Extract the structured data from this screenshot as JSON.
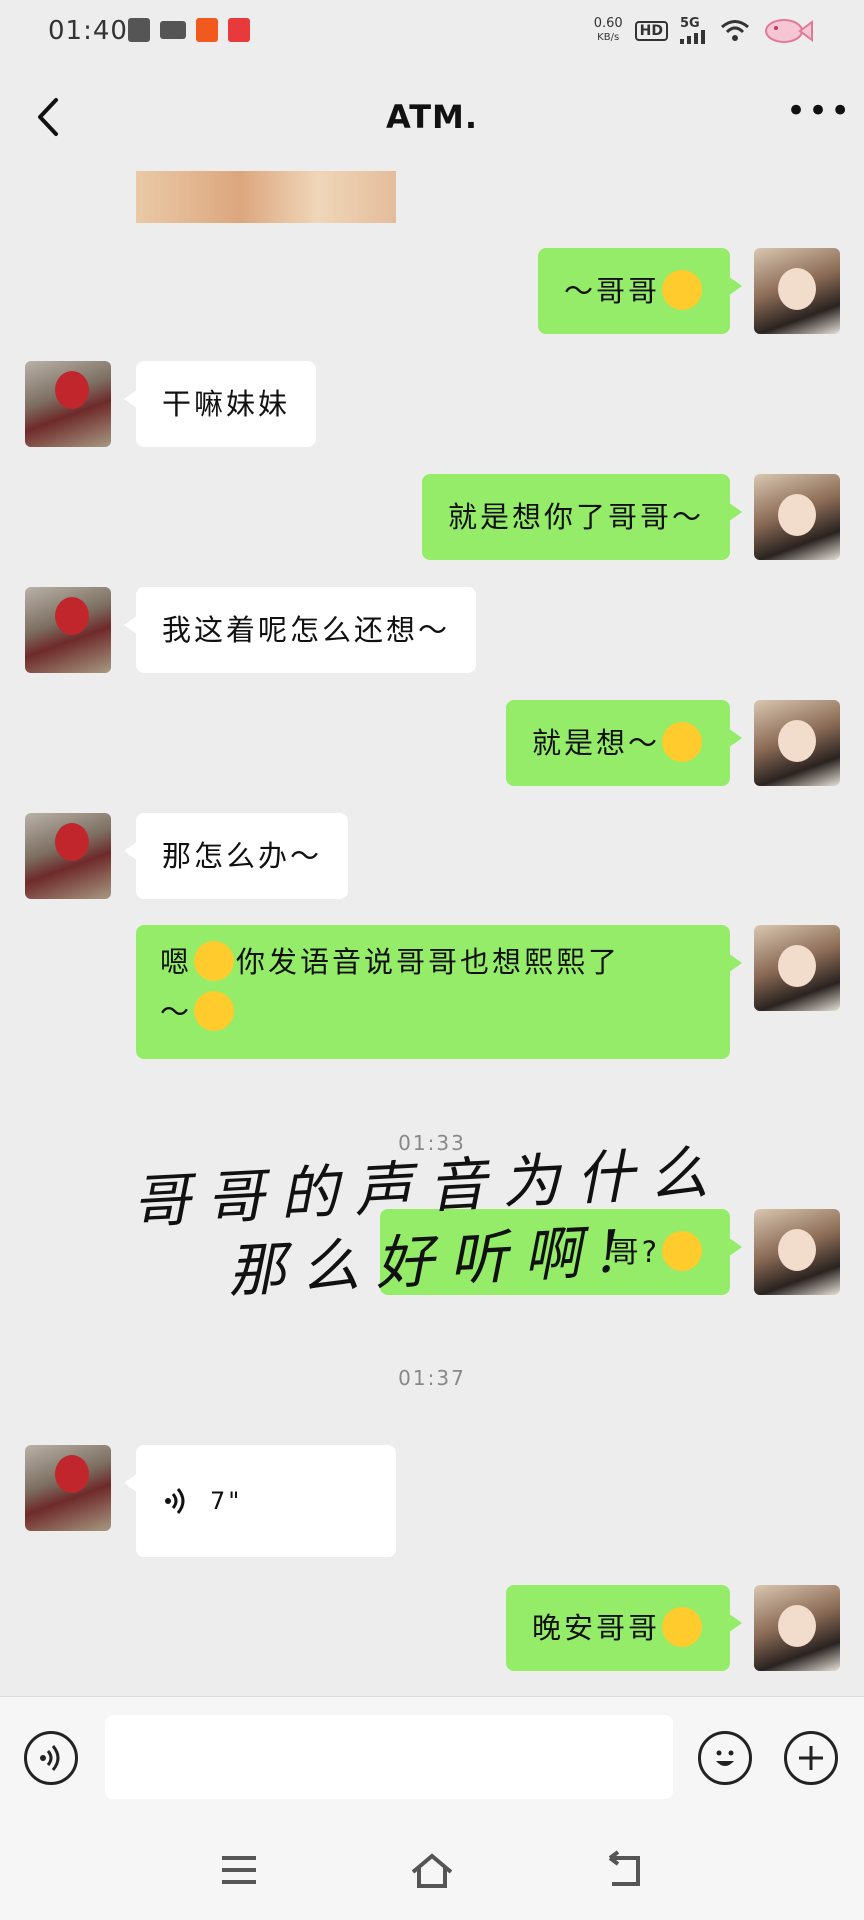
{
  "status_bar": {
    "time": "01:40",
    "net_speed": "0.60",
    "net_unit": "KB/s",
    "hd": "HD",
    "signal": "5G"
  },
  "header": {
    "title": "ATM."
  },
  "messages": [
    {
      "text": "～哥哥",
      "emoji": "winking-face-with-tongue"
    },
    {
      "text": "干嘛妹妹"
    },
    {
      "text": "就是想你了哥哥～"
    },
    {
      "text": "我这着呢怎么还想～"
    },
    {
      "text": "就是想～",
      "emoji": "face-with-hand-over-mouth"
    },
    {
      "text": "那怎么办～"
    },
    {
      "text_before": "嗯",
      "text_mid": "你发语音说哥哥也想熙熙了",
      "text_after": "～"
    },
    {
      "text": "哥",
      "suffix": "?",
      "emoji": "tears-of-joy"
    },
    {
      "duration": "7\""
    },
    {
      "text": "晚安哥哥",
      "emoji": "smiling-face"
    }
  ],
  "timestamps": [
    "01:33",
    "01:37"
  ],
  "overlay_caption": {
    "line1": "哥哥的声音为什么",
    "line2": "那么好听啊!"
  },
  "input": {
    "value": "",
    "placeholder": ""
  },
  "icons": {
    "back": "back-arrow-icon",
    "more": "more-dots-icon",
    "voice": "voice-input-icon",
    "emoji": "emoji-icon",
    "plus": "add-icon"
  },
  "colors": {
    "sent_bubble": "#95ec69",
    "received_bubble": "#ffffff",
    "background": "#ededed"
  }
}
